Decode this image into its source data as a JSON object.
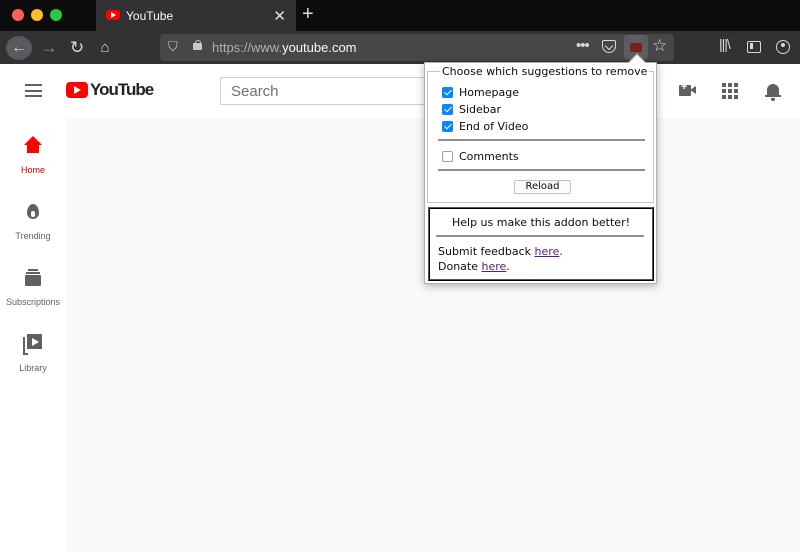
{
  "browser": {
    "tab_title": "YouTube",
    "url_prefix": "https://www.",
    "url_domain": "youtube.com"
  },
  "youtube": {
    "logo_text": "YouTube",
    "search_placeholder": "Search",
    "nav": [
      {
        "label": "Home",
        "icon": "home-icon"
      },
      {
        "label": "Trending",
        "icon": "fire-icon"
      },
      {
        "label": "Subscriptions",
        "icon": "subscriptions-icon"
      },
      {
        "label": "Library",
        "icon": "library-icon"
      }
    ]
  },
  "popup": {
    "legend": "Choose which suggestions to remove",
    "options": [
      {
        "label": "Homepage",
        "checked": true
      },
      {
        "label": "Sidebar",
        "checked": true
      },
      {
        "label": "End of Video",
        "checked": true
      },
      {
        "label": "Comments",
        "checked": false
      }
    ],
    "reload_label": "Reload",
    "help_title": "Help us make this addon better!",
    "feedback_prefix": "Submit feedback ",
    "feedback_link": "here",
    "donate_prefix": "Donate ",
    "donate_link": "here",
    "period": "."
  },
  "colors": {
    "accent": "#0a84ff",
    "youtube_red": "#ff0000",
    "link": "#551a8b"
  }
}
